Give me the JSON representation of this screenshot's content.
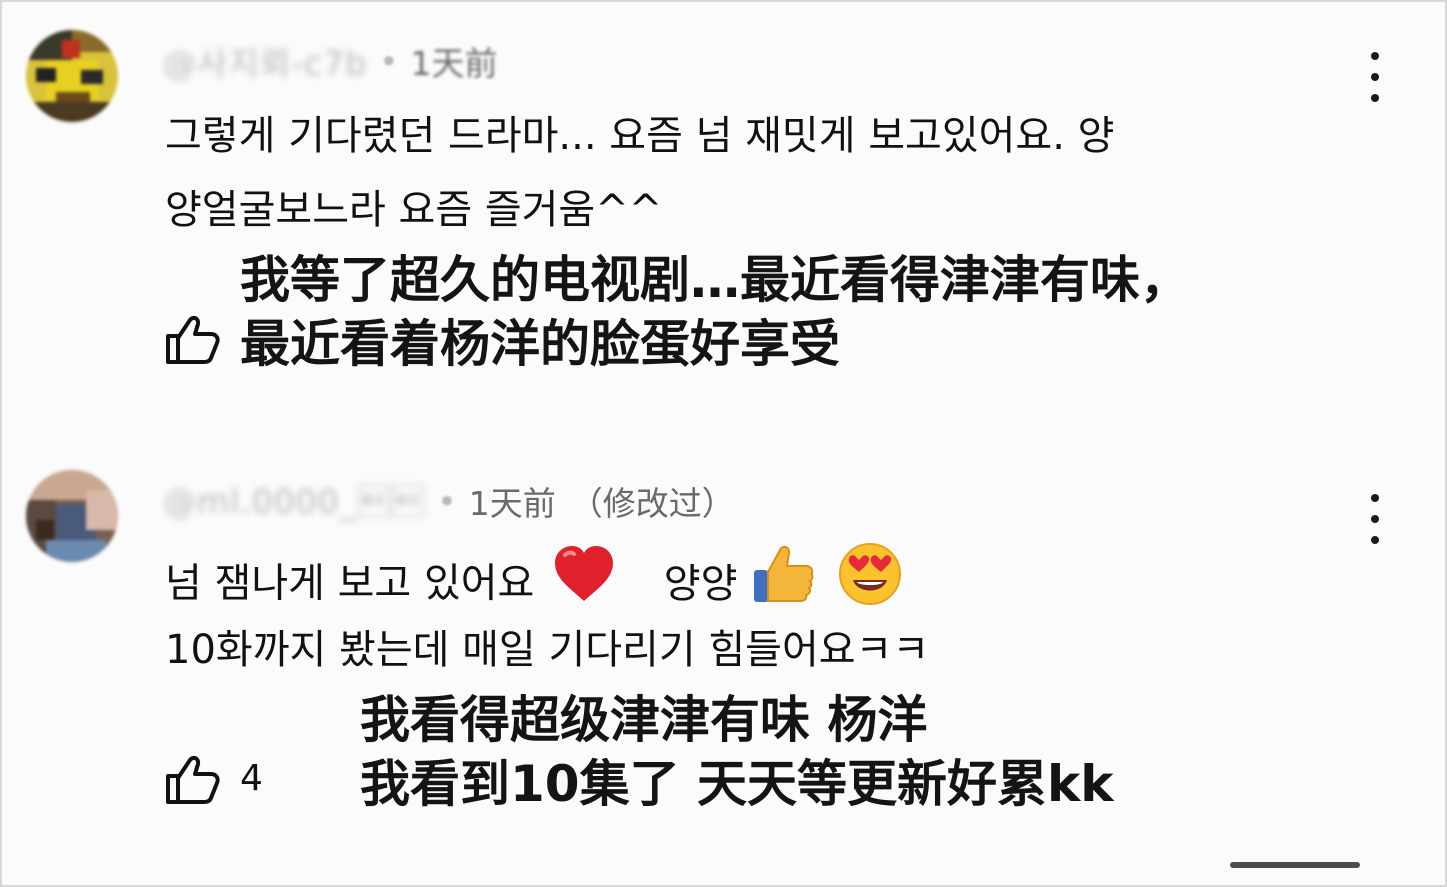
{
  "comments": [
    {
      "handle": "@사지뢰-c7b",
      "separator": "•",
      "time": "1天前",
      "edited": "",
      "text_ko_line1": "그렇게 기다렸던 드라마... 요즘 넘 재밋게 보고있어요. 양",
      "text_ko_line2": "양얼굴보느라 요즘 즐거움^^",
      "text_zh_line1": "我等了超久的电视剧…最近看得津津有味，",
      "text_zh_line2": "最近看着杨洋的脸蛋好享受",
      "like_count": ""
    },
    {
      "handle": "@ml.0000_\b\b",
      "separator": "•",
      "time": "1天前",
      "edited": "（修改过）",
      "text_ko_line1": "넘 잼나게 보고 있어요",
      "text_ko_line1b": "양양",
      "text_ko_line2": "10화까지 봤는데 매일 기다리기 힘들어요ㅋㅋ",
      "text_zh_line1": "我看得超级津津有味 杨洋",
      "text_zh_line2": "我看到10集了 天天等更新好累kk",
      "like_count": "4"
    }
  ],
  "icons": {
    "more": "vertical-ellipsis-icon",
    "like": "thumbs-up-outline-icon",
    "heart": "red-heart-emoji",
    "thumb": "thumbs-up-emoji",
    "hearteyes": "heart-eyes-emoji"
  },
  "colors": {
    "background": "#fbfbfb",
    "text": "#0f0f0f",
    "meta": "#606060"
  }
}
